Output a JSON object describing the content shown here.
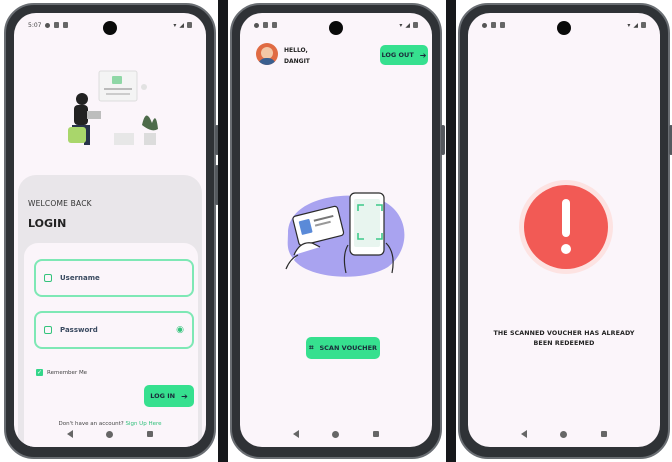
{
  "screen_login": {
    "status_time": "5:07",
    "illustration": "person-at-desk-login-illustration",
    "welcome": "WELCOME BACK",
    "title": "LOGIN",
    "username_placeholder": "Username",
    "password_placeholder": "Password",
    "remember_me": "Remember Me",
    "login_button": "LOG IN",
    "signup_prompt": "Don't have an account?",
    "signup_link": "Sign Up Here"
  },
  "screen_scan": {
    "greeting_line1": "HELLO,",
    "greeting_line2": "DANGIT",
    "logout_button": "LOG OUT",
    "illustration": "hands-scanning-card-with-phone",
    "scan_button": "SCAN VOUCHER"
  },
  "screen_error": {
    "icon": "exclamation-alert-icon",
    "message": "THE SCANNED VOUCHER HAS ALREADY BEEN REDEEMED"
  },
  "colors": {
    "accent_green": "#36e08f",
    "field_border": "#7ee8b5",
    "error_red": "#f25a55",
    "screen_bg": "#fbf5fa",
    "blob_purple": "#a9a3f0"
  }
}
